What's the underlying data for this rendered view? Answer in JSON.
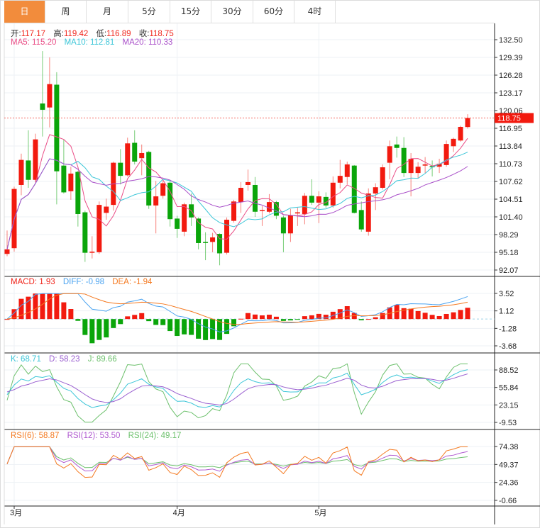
{
  "tabs": [
    {
      "label": "日",
      "active": true
    },
    {
      "label": "周"
    },
    {
      "label": "月"
    },
    {
      "label": "5分"
    },
    {
      "label": "15分"
    },
    {
      "label": "30分"
    },
    {
      "label": "60分"
    },
    {
      "label": "4时"
    }
  ],
  "ohlc_legend": {
    "open_label": "开:",
    "open": "117.17",
    "high_label": "高:",
    "high": "119.42",
    "low_label": "低:",
    "low": "116.89",
    "close_label": "收:",
    "close": "118.75"
  },
  "ma_legend": {
    "ma5": "MA5: 115.20",
    "ma10": "MA10: 112.81",
    "ma20": "MA20: 110.33"
  },
  "macd_legend": {
    "macd": "MACD: 1.93",
    "diff": "DIFF: -0.98",
    "dea": "DEA: -1.94"
  },
  "kdj_legend": {
    "k": "K: 68.71",
    "d": "D: 58.23",
    "j": "J: 89.66"
  },
  "rsi_legend": {
    "rsi6": "RSI(6): 58.87",
    "rsi12": "RSI(12): 53.50",
    "rsi24": "RSI(24): 49.17"
  },
  "last_price": "118.75",
  "colors": {
    "up": "#f21a0f",
    "down": "#0aa50a",
    "ma5": "#ea4d86",
    "ma10": "#3cc6d8",
    "ma20": "#a94fc9",
    "diff": "#4aa3f0",
    "dea": "#f47920",
    "k": "#3cc6d8",
    "d": "#9a5fd0",
    "j": "#6cc06c",
    "rsi6": "#f47920",
    "rsi12": "#b05ad0",
    "rsi24": "#6cc06c",
    "tab_active": "#f28c3c"
  },
  "chart_data": {
    "type": "candlestick",
    "xlabels": [
      {
        "index": 1,
        "label": "3月"
      },
      {
        "index": 24,
        "label": "4月"
      },
      {
        "index": 44,
        "label": "5月"
      }
    ],
    "price_ticks": [
      "132.50",
      "129.39",
      "126.28",
      "123.17",
      "120.06",
      "116.95",
      "113.84",
      "110.73",
      "107.62",
      "104.51",
      "101.40",
      "98.29",
      "95.18",
      "92.07"
    ],
    "price_range": [
      92.07,
      132.5
    ],
    "macd_ticks": [
      "3.52",
      "1.12",
      "-1.28",
      "-3.68"
    ],
    "macd_range": [
      -3.68,
      3.52
    ],
    "kdj_ticks": [
      "88.52",
      "55.84",
      "23.15",
      "-9.53"
    ],
    "kdj_range": [
      -9.53,
      88.52
    ],
    "rsi_ticks": [
      "74.38",
      "49.37",
      "24.36",
      "-0.66"
    ],
    "rsi_range": [
      -0.66,
      74.38
    ],
    "candles": [
      [
        94.9,
        99.0,
        94.5,
        95.7
      ],
      [
        95.9,
        106.7,
        95.3,
        106.3
      ],
      [
        107.0,
        112.5,
        105.2,
        111.4
      ],
      [
        111.3,
        116.6,
        106.5,
        107.9
      ],
      [
        107.9,
        116.0,
        107.5,
        115.0
      ],
      [
        121.3,
        130.5,
        115.5,
        120.2
      ],
      [
        120.6,
        129.4,
        117.1,
        124.7
      ],
      [
        124.6,
        126.8,
        103.6,
        109.4
      ],
      [
        110.4,
        115.0,
        105.5,
        105.7
      ],
      [
        105.9,
        110.2,
        104.4,
        109.0
      ],
      [
        109.3,
        109.5,
        99.7,
        101.9
      ],
      [
        102.2,
        102.5,
        93.5,
        95.1
      ],
      [
        95.1,
        98.0,
        94.1,
        95.3
      ],
      [
        95.2,
        104.1,
        94.9,
        103.5
      ],
      [
        102.1,
        104.6,
        100.9,
        103.2
      ],
      [
        103.5,
        111.1,
        102.5,
        110.9
      ],
      [
        110.9,
        113.3,
        107.1,
        108.6
      ],
      [
        108.7,
        115.3,
        108.5,
        114.3
      ],
      [
        114.4,
        116.6,
        110.6,
        111.1
      ],
      [
        111.7,
        114.1,
        108.7,
        112.6
      ],
      [
        112.8,
        113.0,
        102.8,
        103.4
      ],
      [
        103.4,
        107.7,
        98.5,
        105.0
      ],
      [
        105.1,
        107.7,
        104.6,
        107.3
      ],
      [
        107.4,
        107.7,
        99.7,
        101.0
      ],
      [
        101.1,
        101.6,
        97.7,
        99.3
      ],
      [
        98.8,
        103.9,
        98.0,
        103.6
      ],
      [
        103.6,
        105.5,
        99.8,
        101.3
      ],
      [
        101.1,
        101.3,
        95.7,
        96.8
      ],
      [
        97.0,
        98.7,
        93.8,
        96.9
      ],
      [
        97.0,
        98.6,
        95.2,
        97.8
      ],
      [
        98.4,
        98.5,
        92.9,
        95.0
      ],
      [
        95.1,
        101.3,
        94.8,
        100.9
      ],
      [
        100.7,
        104.4,
        100.4,
        104.1
      ],
      [
        104.0,
        107.5,
        102.1,
        106.5
      ],
      [
        107.0,
        109.7,
        106.0,
        107.5
      ],
      [
        107.0,
        108.4,
        101.4,
        102.3
      ],
      [
        102.5,
        103.3,
        99.8,
        102.6
      ],
      [
        102.3,
        105.4,
        102.0,
        104.0
      ],
      [
        104.0,
        104.2,
        101.0,
        101.6
      ],
      [
        101.3,
        101.6,
        95.2,
        98.5
      ],
      [
        98.5,
        102.8,
        97.0,
        101.7
      ],
      [
        102.0,
        103.0,
        99.8,
        102.2
      ],
      [
        101.9,
        105.6,
        100.1,
        105.1
      ],
      [
        105.1,
        108.0,
        103.5,
        103.9
      ],
      [
        103.9,
        105.9,
        100.3,
        105.0
      ],
      [
        104.9,
        105.7,
        103.0,
        103.4
      ],
      [
        103.4,
        108.5,
        103.0,
        107.4
      ],
      [
        107.4,
        111.4,
        106.4,
        108.6
      ],
      [
        108.4,
        111.1,
        107.1,
        110.6
      ],
      [
        110.4,
        110.5,
        102.0,
        102.1
      ],
      [
        102.6,
        104.1,
        98.8,
        99.2
      ],
      [
        98.8,
        106.4,
        98.1,
        105.5
      ],
      [
        105.5,
        107.3,
        102.6,
        106.6
      ],
      [
        106.5,
        110.6,
        106.2,
        110.1
      ],
      [
        110.9,
        114.8,
        108.0,
        113.8
      ],
      [
        114.1,
        115.5,
        111.8,
        113.5
      ],
      [
        113.5,
        115.4,
        108.4,
        109.1
      ],
      [
        109.1,
        112.6,
        105.0,
        111.6
      ],
      [
        109.1,
        111.0,
        108.2,
        110.2
      ],
      [
        110.4,
        111.9,
        109.1,
        110.6
      ],
      [
        110.3,
        111.3,
        108.5,
        110.1
      ],
      [
        110.2,
        111.6,
        109.1,
        110.7
      ],
      [
        110.5,
        114.8,
        110.2,
        114.2
      ],
      [
        113.8,
        115.3,
        112.8,
        115.1
      ],
      [
        114.8,
        117.4,
        114.6,
        117.2
      ],
      [
        117.17,
        119.42,
        116.89,
        118.75
      ]
    ]
  }
}
